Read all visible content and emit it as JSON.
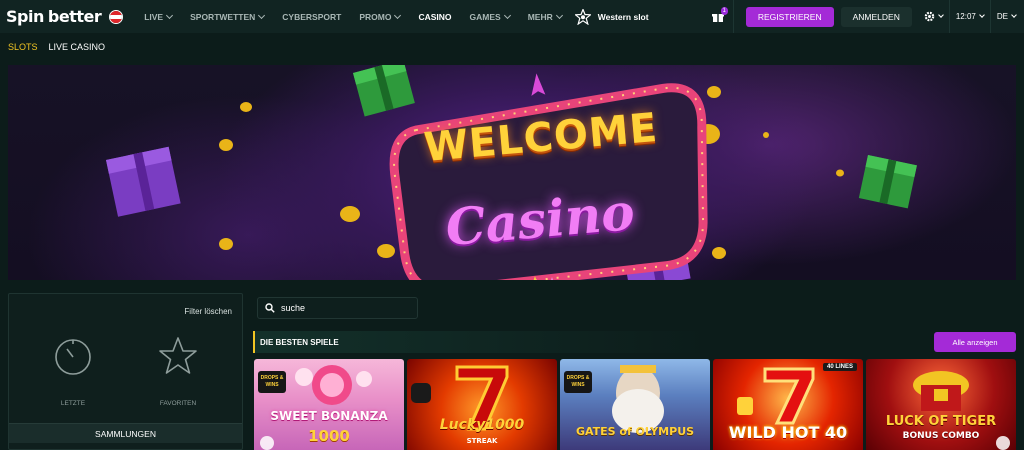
{
  "colors": {
    "accent_purple": "#a42ad7",
    "accent_yellow": "#f2c523",
    "bg": "#0c1c1a",
    "nav_bg": "#112422"
  },
  "header": {
    "logo_spin": "Spin",
    "logo_better": "better",
    "nav": [
      {
        "label": "LIVE",
        "dropdown": true
      },
      {
        "label": "SPORTWETTEN",
        "dropdown": true
      },
      {
        "label": "CYBERSPORT",
        "dropdown": false
      },
      {
        "label": "PROMO",
        "dropdown": true
      },
      {
        "label": "CASINO",
        "dropdown": false,
        "active": true
      },
      {
        "label": "GAMES",
        "dropdown": true
      },
      {
        "label": "MEHR",
        "dropdown": true
      }
    ],
    "western_slot": "Western slot",
    "gift_badge": "1",
    "register": "REGISTRIEREN",
    "login": "ANMELDEN",
    "time": "12:07",
    "lang": "DE"
  },
  "subnav": {
    "slots": "SLOTS",
    "live_casino": "LIVE CASINO"
  },
  "banner": {
    "line1": "WELCOME",
    "line2": "Casino"
  },
  "sidebar": {
    "filter_clear": "Filter löschen",
    "recent": "LETZTE",
    "favorites": "FAVORITEN",
    "collections": "SAMMLUNGEN"
  },
  "search": {
    "value": "suche"
  },
  "section": {
    "title": "DIE BESTEN SPIELE",
    "show_all": "Alle anzeigen"
  },
  "games": [
    {
      "title_top": "SWEET BONANZA",
      "title_bottom": "1000",
      "badge": "DROPS & WINS"
    },
    {
      "title_top": "Lucky",
      "title_bottom": "1000",
      "sub": "STREAK"
    },
    {
      "title_top": "GATES of OLYMPUS",
      "badge": "DROPS & WINS"
    },
    {
      "title_top": "WILD HOT 40",
      "badge2": "40 LINES"
    },
    {
      "title_top": "LUCK OF TIGER",
      "title_bottom": "BONUS COMBO"
    }
  ]
}
